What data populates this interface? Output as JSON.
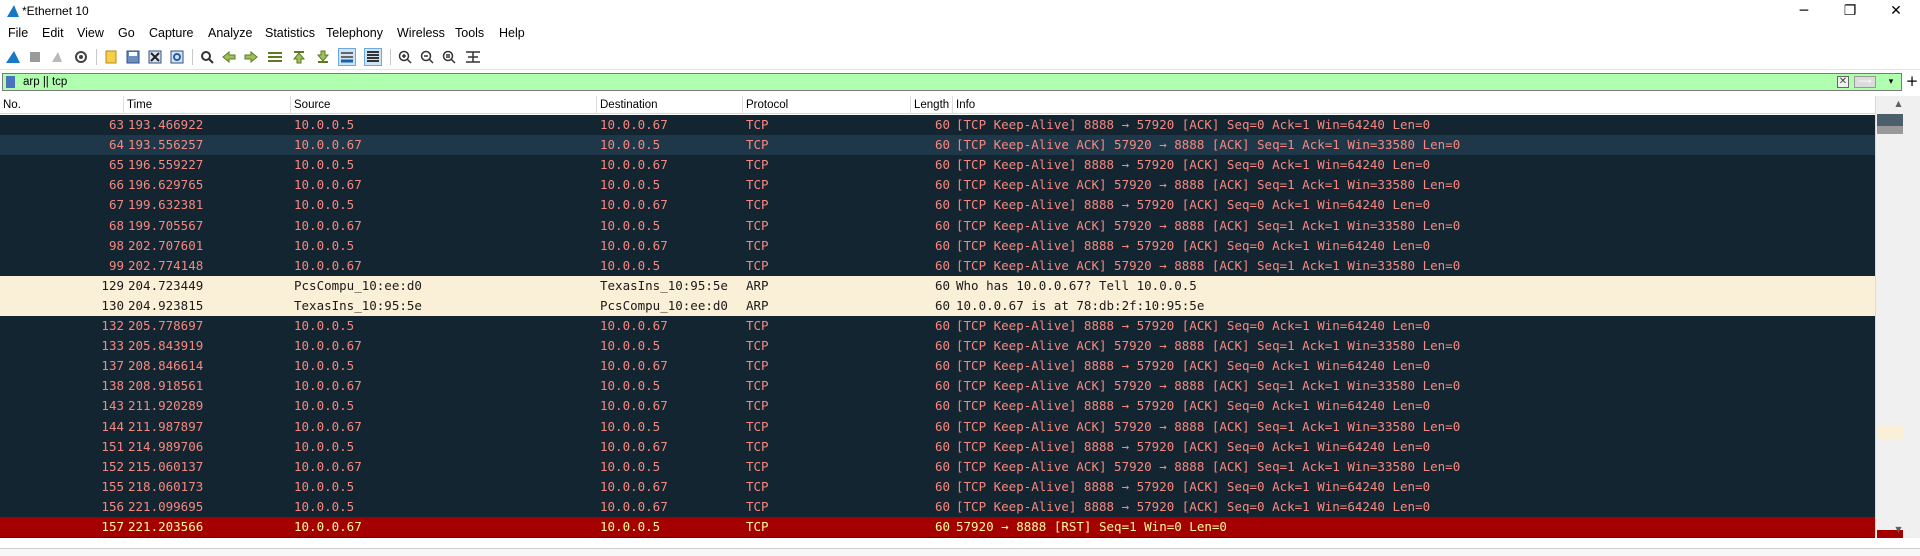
{
  "window": {
    "title": "*Ethernet 10",
    "controls": {
      "minimize": "─",
      "maximize": "❐",
      "close": "✕"
    }
  },
  "menu": [
    "File",
    "Edit",
    "View",
    "Go",
    "Capture",
    "Analyze",
    "Statistics",
    "Telephony",
    "Wireless",
    "Tools",
    "Help"
  ],
  "toolbar": {
    "icons": [
      "shark-fin-start-icon",
      "stop-capture-icon",
      "restart-capture-icon",
      "capture-options-icon",
      "open-file-icon",
      "save-file-icon",
      "close-file-icon",
      "reload-file-icon",
      "find-packet-icon",
      "go-back-icon",
      "go-forward-icon",
      "go-to-packet-icon",
      "go-first-icon",
      "go-last-icon",
      "autoscroll-icon",
      "colorize-icon",
      "zoom-in-icon",
      "zoom-out-icon",
      "normal-size-icon",
      "resize-columns-icon"
    ]
  },
  "filter": {
    "value": "arp || tcp",
    "clear_glyph": "✕",
    "apply_glyph": "⟶",
    "dropdown_glyph": "▾",
    "add_glyph": "+"
  },
  "columns": [
    "No.",
    "Time",
    "Source",
    "Destination",
    "Protocol",
    "Length",
    "Info"
  ],
  "colors": {
    "tcp_row_bg": "#122530",
    "tcp_row_fg": "#f78880",
    "selected_row_bg": "#1e3849",
    "arp_row_bg": "#faf0d7",
    "rst_row_bg": "#a40000",
    "rst_row_fg": "#fffc9c",
    "filter_bg": "#afffaf"
  },
  "packets": [
    {
      "no": "63",
      "time": "193.466922",
      "src": "10.0.0.5",
      "dst": "10.0.0.67",
      "proto": "TCP",
      "len": "60",
      "info": "[TCP Keep-Alive] 8888 → 57920 [ACK] Seq=0 Ack=1 Win=64240 Len=0",
      "kind": "tcp"
    },
    {
      "no": "64",
      "time": "193.556257",
      "src": "10.0.0.67",
      "dst": "10.0.0.5",
      "proto": "TCP",
      "len": "60",
      "info": "[TCP Keep-Alive ACK] 57920 → 8888 [ACK] Seq=1 Ack=1 Win=33580 Len=0",
      "kind": "sel"
    },
    {
      "no": "65",
      "time": "196.559227",
      "src": "10.0.0.5",
      "dst": "10.0.0.67",
      "proto": "TCP",
      "len": "60",
      "info": "[TCP Keep-Alive] 8888 → 57920 [ACK] Seq=0 Ack=1 Win=64240 Len=0",
      "kind": "tcp"
    },
    {
      "no": "66",
      "time": "196.629765",
      "src": "10.0.0.67",
      "dst": "10.0.0.5",
      "proto": "TCP",
      "len": "60",
      "info": "[TCP Keep-Alive ACK] 57920 → 8888 [ACK] Seq=1 Ack=1 Win=33580 Len=0",
      "kind": "tcp"
    },
    {
      "no": "67",
      "time": "199.632381",
      "src": "10.0.0.5",
      "dst": "10.0.0.67",
      "proto": "TCP",
      "len": "60",
      "info": "[TCP Keep-Alive] 8888 → 57920 [ACK] Seq=0 Ack=1 Win=64240 Len=0",
      "kind": "tcp"
    },
    {
      "no": "68",
      "time": "199.705567",
      "src": "10.0.0.67",
      "dst": "10.0.0.5",
      "proto": "TCP",
      "len": "60",
      "info": "[TCP Keep-Alive ACK] 57920 → 8888 [ACK] Seq=1 Ack=1 Win=33580 Len=0",
      "kind": "tcp"
    },
    {
      "no": "98",
      "time": "202.707601",
      "src": "10.0.0.5",
      "dst": "10.0.0.67",
      "proto": "TCP",
      "len": "60",
      "info": "[TCP Keep-Alive] 8888 → 57920 [ACK] Seq=0 Ack=1 Win=64240 Len=0",
      "kind": "tcp"
    },
    {
      "no": "99",
      "time": "202.774148",
      "src": "10.0.0.67",
      "dst": "10.0.0.5",
      "proto": "TCP",
      "len": "60",
      "info": "[TCP Keep-Alive ACK] 57920 → 8888 [ACK] Seq=1 Ack=1 Win=33580 Len=0",
      "kind": "tcp"
    },
    {
      "no": "129",
      "time": "204.723449",
      "src": "PcsCompu_10:ee:d0",
      "dst": "TexasIns_10:95:5e",
      "proto": "ARP",
      "len": "60",
      "info": "Who has 10.0.0.67? Tell 10.0.0.5",
      "kind": "arp"
    },
    {
      "no": "130",
      "time": "204.923815",
      "src": "TexasIns_10:95:5e",
      "dst": "PcsCompu_10:ee:d0",
      "proto": "ARP",
      "len": "60",
      "info": "10.0.0.67 is at 78:db:2f:10:95:5e",
      "kind": "arp"
    },
    {
      "no": "132",
      "time": "205.778697",
      "src": "10.0.0.5",
      "dst": "10.0.0.67",
      "proto": "TCP",
      "len": "60",
      "info": "[TCP Keep-Alive] 8888 → 57920 [ACK] Seq=0 Ack=1 Win=64240 Len=0",
      "kind": "tcp"
    },
    {
      "no": "133",
      "time": "205.843919",
      "src": "10.0.0.67",
      "dst": "10.0.0.5",
      "proto": "TCP",
      "len": "60",
      "info": "[TCP Keep-Alive ACK] 57920 → 8888 [ACK] Seq=1 Ack=1 Win=33580 Len=0",
      "kind": "tcp"
    },
    {
      "no": "137",
      "time": "208.846614",
      "src": "10.0.0.5",
      "dst": "10.0.0.67",
      "proto": "TCP",
      "len": "60",
      "info": "[TCP Keep-Alive] 8888 → 57920 [ACK] Seq=0 Ack=1 Win=64240 Len=0",
      "kind": "tcp"
    },
    {
      "no": "138",
      "time": "208.918561",
      "src": "10.0.0.67",
      "dst": "10.0.0.5",
      "proto": "TCP",
      "len": "60",
      "info": "[TCP Keep-Alive ACK] 57920 → 8888 [ACK] Seq=1 Ack=1 Win=33580 Len=0",
      "kind": "tcp"
    },
    {
      "no": "143",
      "time": "211.920289",
      "src": "10.0.0.5",
      "dst": "10.0.0.67",
      "proto": "TCP",
      "len": "60",
      "info": "[TCP Keep-Alive] 8888 → 57920 [ACK] Seq=0 Ack=1 Win=64240 Len=0",
      "kind": "tcp"
    },
    {
      "no": "144",
      "time": "211.987897",
      "src": "10.0.0.67",
      "dst": "10.0.0.5",
      "proto": "TCP",
      "len": "60",
      "info": "[TCP Keep-Alive ACK] 57920 → 8888 [ACK] Seq=1 Ack=1 Win=33580 Len=0",
      "kind": "tcp"
    },
    {
      "no": "151",
      "time": "214.989706",
      "src": "10.0.0.5",
      "dst": "10.0.0.67",
      "proto": "TCP",
      "len": "60",
      "info": "[TCP Keep-Alive] 8888 → 57920 [ACK] Seq=0 Ack=1 Win=64240 Len=0",
      "kind": "tcp"
    },
    {
      "no": "152",
      "time": "215.060137",
      "src": "10.0.0.67",
      "dst": "10.0.0.5",
      "proto": "TCP",
      "len": "60",
      "info": "[TCP Keep-Alive ACK] 57920 → 8888 [ACK] Seq=1 Ack=1 Win=33580 Len=0",
      "kind": "tcp"
    },
    {
      "no": "155",
      "time": "218.060173",
      "src": "10.0.0.5",
      "dst": "10.0.0.67",
      "proto": "TCP",
      "len": "60",
      "info": "[TCP Keep-Alive] 8888 → 57920 [ACK] Seq=0 Ack=1 Win=64240 Len=0",
      "kind": "tcp"
    },
    {
      "no": "156",
      "time": "221.099695",
      "src": "10.0.0.5",
      "dst": "10.0.0.67",
      "proto": "TCP",
      "len": "60",
      "info": "[TCP Keep-Alive] 8888 → 57920 [ACK] Seq=0 Ack=1 Win=64240 Len=0",
      "kind": "tcp"
    },
    {
      "no": "157",
      "time": "221.203566",
      "src": "10.0.0.67",
      "dst": "10.0.0.5",
      "proto": "TCP",
      "len": "60",
      "info": "57920 → 8888 [RST] Seq=1 Win=0 Len=0",
      "kind": "rst"
    }
  ],
  "scrollbar": {
    "up_glyph": "▲",
    "down_glyph": "▼"
  }
}
